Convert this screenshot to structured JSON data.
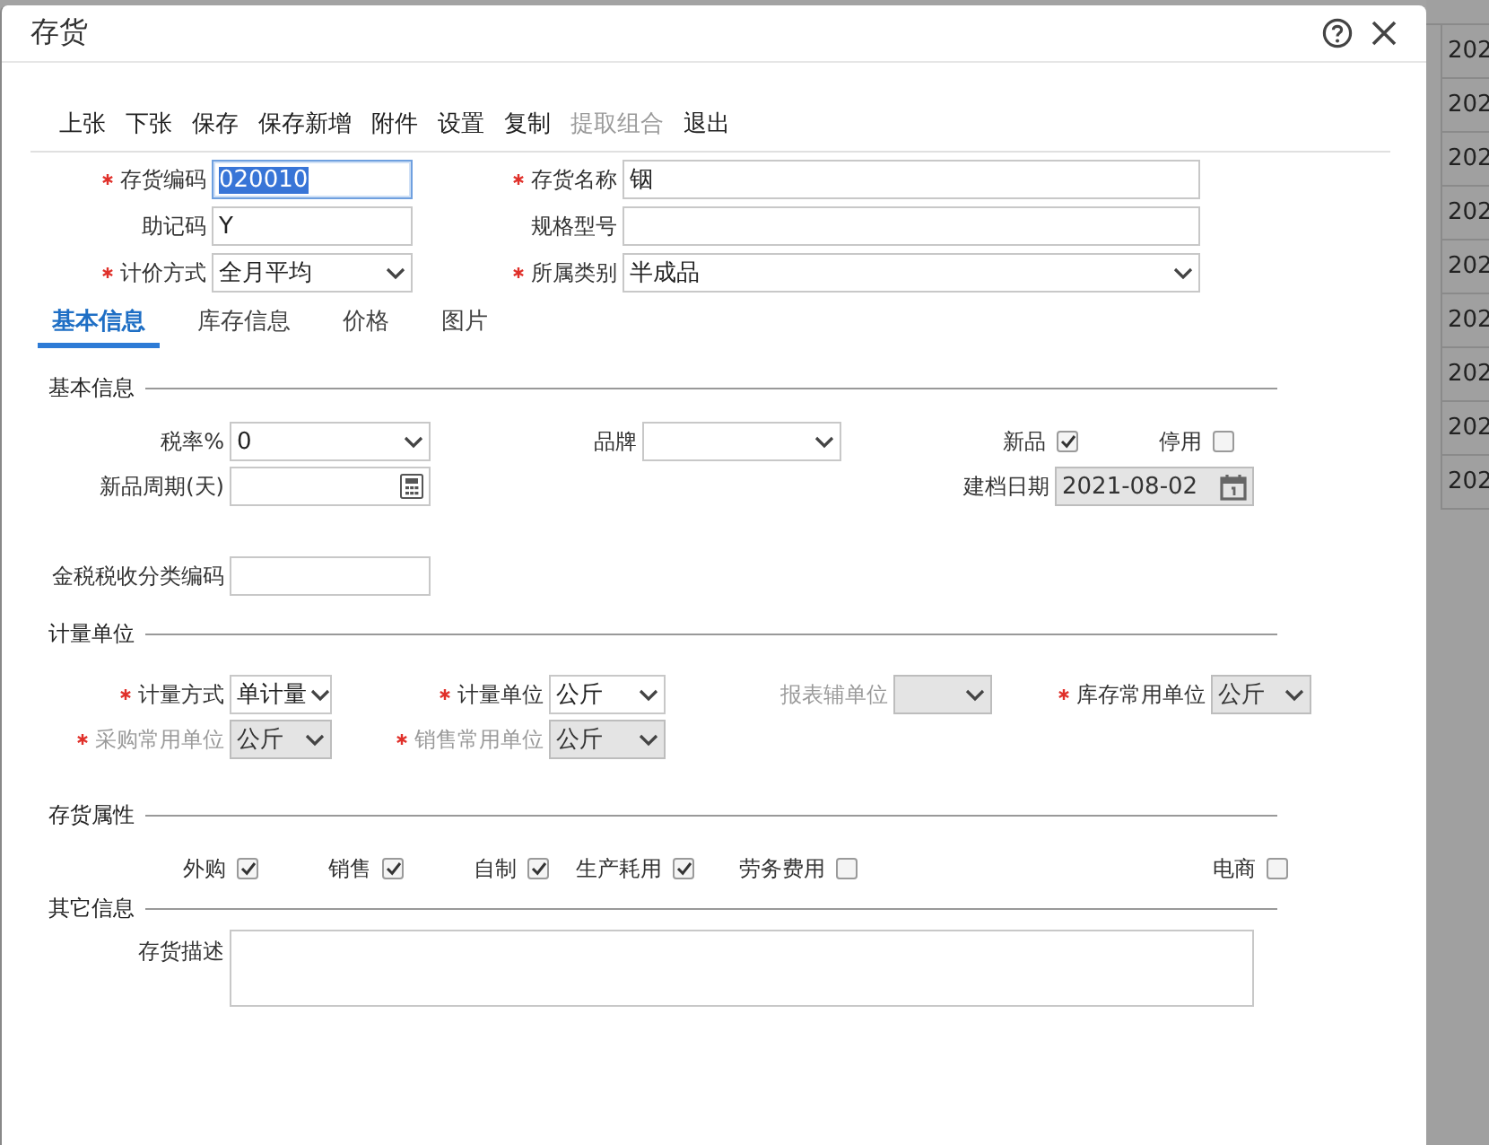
{
  "window": {
    "title": "存货"
  },
  "toolbar": [
    {
      "label": "上张",
      "disabled": false
    },
    {
      "label": "下张",
      "disabled": false
    },
    {
      "label": "保存",
      "disabled": false
    },
    {
      "label": "保存新增",
      "disabled": false
    },
    {
      "label": "附件",
      "disabled": false
    },
    {
      "label": "设置",
      "disabled": false
    },
    {
      "label": "复制",
      "disabled": false
    },
    {
      "label": "提取组合",
      "disabled": true
    },
    {
      "label": "退出",
      "disabled": false
    }
  ],
  "header": {
    "rows": [
      [
        {
          "kind": "text",
          "label": "存货编码",
          "required": true,
          "disabled": false,
          "focused": true,
          "value": "020010"
        },
        {
          "kind": "text",
          "label": "存货名称",
          "required": true,
          "disabled": false,
          "focused": false,
          "value": "铟"
        }
      ],
      [
        {
          "kind": "text",
          "label": "助记码",
          "required": false,
          "disabled": false,
          "focused": false,
          "value": "Y"
        },
        {
          "kind": "text",
          "label": "规格型号",
          "required": false,
          "disabled": false,
          "focused": false
        }
      ],
      [
        {
          "kind": "select",
          "label": "计价方式",
          "required": true,
          "disabled": false,
          "focused": false,
          "value": "全月平均"
        },
        {
          "kind": "select",
          "label": "所属类别",
          "required": true,
          "disabled": false,
          "focused": false,
          "value": "半成品"
        }
      ]
    ]
  },
  "tabs": [
    {
      "label": "基本信息",
      "selected": true
    },
    {
      "label": "库存信息",
      "selected": false
    },
    {
      "label": "价格",
      "selected": false
    },
    {
      "label": "图片",
      "selected": false
    }
  ],
  "sections": [
    {
      "title": "基本信息",
      "rows": [
        [
          {
            "kind": "select",
            "label": "税率%",
            "required": false,
            "disabled": false,
            "value": "0"
          },
          {
            "kind": "select",
            "label": "品牌",
            "required": false,
            "disabled": false
          },
          {
            "kind": "checkbox",
            "label": "新品",
            "checked": true
          },
          {
            "kind": "checkbox",
            "label": "停用",
            "checked": false
          }
        ],
        [
          {
            "kind": "calc",
            "label": "新品周期(天)",
            "required": false,
            "disabled": false
          },
          "",
          {
            "kind": "date",
            "label": "建档日期",
            "required": false,
            "disabled": true,
            "value": "2021-08-02"
          }
        ],
        [
          {
            "kind": "text",
            "label": "金税税收分类编码",
            "required": false,
            "disabled": false
          }
        ]
      ]
    },
    {
      "title": "计量单位",
      "rows": [
        [
          {
            "kind": "select",
            "label": "计量方式",
            "required": true,
            "disabled": false,
            "label_dimmed": false,
            "value": "单计量"
          },
          {
            "kind": "select",
            "label": "计量单位",
            "required": true,
            "disabled": false,
            "label_dimmed": false,
            "value": "公斤"
          },
          {
            "kind": "select",
            "label": "报表辅单位",
            "required": false,
            "disabled": true,
            "label_dimmed": true
          },
          {
            "kind": "select",
            "label": "库存常用单位",
            "required": true,
            "disabled": true,
            "label_dimmed": false,
            "value": "公斤"
          }
        ],
        [
          {
            "kind": "select",
            "label": "采购常用单位",
            "required": true,
            "disabled": true,
            "label_dimmed": true,
            "value": "公斤"
          },
          {
            "kind": "select",
            "label": "销售常用单位",
            "required": true,
            "disabled": true,
            "label_dimmed": true,
            "value": "公斤"
          }
        ]
      ]
    },
    {
      "title": "存货属性",
      "rows": [
        [
          {
            "kind": "checkbox",
            "label": "外购",
            "checked": true
          },
          {
            "kind": "checkbox",
            "label": "销售",
            "checked": true
          },
          {
            "kind": "checkbox",
            "label": "自制",
            "checked": true
          },
          {
            "kind": "checkbox",
            "label": "生产耗用",
            "checked": true
          },
          {
            "kind": "checkbox",
            "label": "劳务费用",
            "checked": false
          },
          {
            "kind": "checkbox",
            "label": "电商",
            "checked": false
          }
        ]
      ]
    },
    {
      "title": "其它信息",
      "rows": [
        [
          {
            "kind": "textarea",
            "label": "存货描述",
            "required": false,
            "disabled": false
          }
        ]
      ]
    }
  ],
  "background_table": {
    "cells": [
      "202",
      "202",
      "202",
      "202",
      "202",
      "202",
      "202",
      "202",
      "202"
    ]
  }
}
